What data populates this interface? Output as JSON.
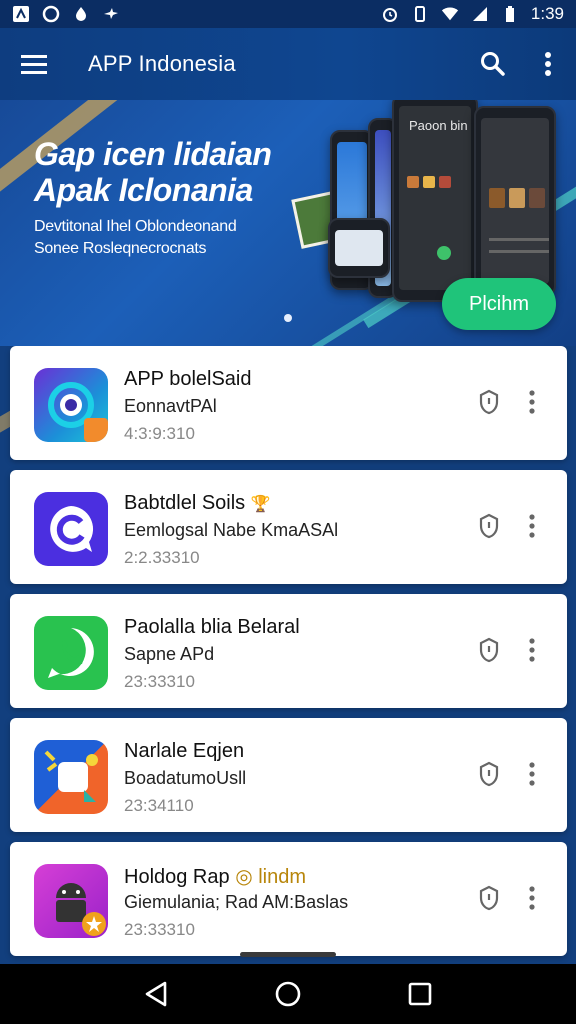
{
  "status_bar": {
    "time": "1:39",
    "left_icons": [
      "app-notification-icon",
      "circle-icon",
      "drop-icon",
      "bird-icon"
    ],
    "right_icons": [
      "alarm-icon",
      "vibrate-icon",
      "wifi-icon",
      "signal-icon",
      "battery-icon"
    ]
  },
  "app_bar": {
    "title": "APP Indonesia"
  },
  "banner": {
    "headline_line1": "Gap icen lidaian",
    "headline_line2": "Apak Iclonania",
    "sub_line1": "Devtitonal Ihel Oblondeonand",
    "sub_line2": "Sonee Rosleqnecrocnats",
    "phone_label": "Paoon bin",
    "cta_label": "Plcihm"
  },
  "apps": [
    {
      "title": "APP bolelSaid",
      "subtitle": "EonnavtPAl",
      "meta": "4:3:9:310",
      "icon": "circle-app-icon",
      "icon_colors": [
        "#5b2bd6",
        "#1cc6d8",
        "#f28b2c"
      ]
    },
    {
      "title": "Babtdlel Soils",
      "title_badge": "🏆",
      "subtitle": "Eemlogsal Nabe KmaASAl",
      "meta": "2:2.33310",
      "icon": "chat-bubble-app-icon",
      "icon_colors": [
        "#4b2fe0"
      ]
    },
    {
      "title": "Paolalla blia Belaral",
      "subtitle": "Sapne APd",
      "meta": "23:33310",
      "icon": "phone-app-icon",
      "icon_colors": [
        "#29c24f"
      ]
    },
    {
      "title": "Narlale Eqjen",
      "subtitle": "BoadatumoUsll",
      "meta": "23:34110",
      "icon": "media-app-icon",
      "icon_colors": [
        "#1f5fd6",
        "#f0642a",
        "#2bb3a4"
      ]
    },
    {
      "title": "Holdog Rap",
      "title_badge": "◎ lindm",
      "subtitle": "Giemulania; Rad AM:Baslas",
      "meta": "23:33310",
      "icon": "android-app-icon",
      "icon_colors": [
        "#c72fd6",
        "#f0a21c"
      ]
    }
  ],
  "nav_bar": {
    "buttons": [
      "back-icon",
      "home-icon",
      "recents-icon"
    ]
  }
}
